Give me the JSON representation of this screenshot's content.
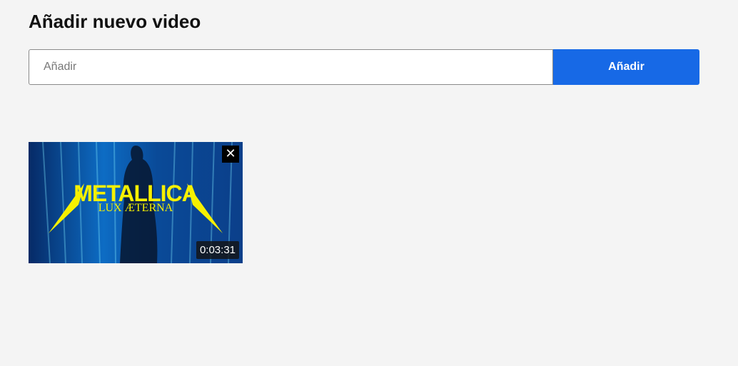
{
  "header": {
    "title": "Añadir nuevo video"
  },
  "add_form": {
    "input_placeholder": "Añadir",
    "input_value": "",
    "button_label": "Añadir",
    "button_color": "#1769e6"
  },
  "videos": [
    {
      "thumbnail_logo_text": "METALLICA",
      "thumbnail_subtitle_text": "LUX ÆTERNA",
      "duration": "0:03:31",
      "remove_icon": "close-icon",
      "remove_symbol": "✕"
    }
  ]
}
